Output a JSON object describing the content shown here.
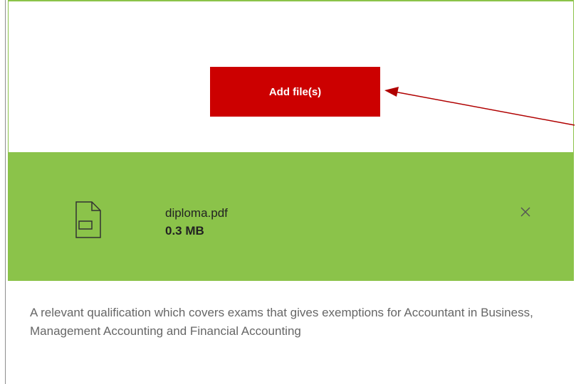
{
  "upload": {
    "add_button_label": "Add file(s)"
  },
  "file": {
    "name": "diploma.pdf",
    "size": "0.3 MB",
    "icon": "document-icon",
    "remove_icon": "close-icon"
  },
  "description": "A relevant qualification which covers exams that gives exemptions for Accountant in Business, Management Accounting and Financial Accounting",
  "colors": {
    "panel_border": "#8bc34a",
    "file_row_bg": "#8bc34a",
    "button_bg": "#cc0000",
    "button_text": "#ffffff",
    "annotation_arrow": "#b00000",
    "description_text": "#666666"
  }
}
